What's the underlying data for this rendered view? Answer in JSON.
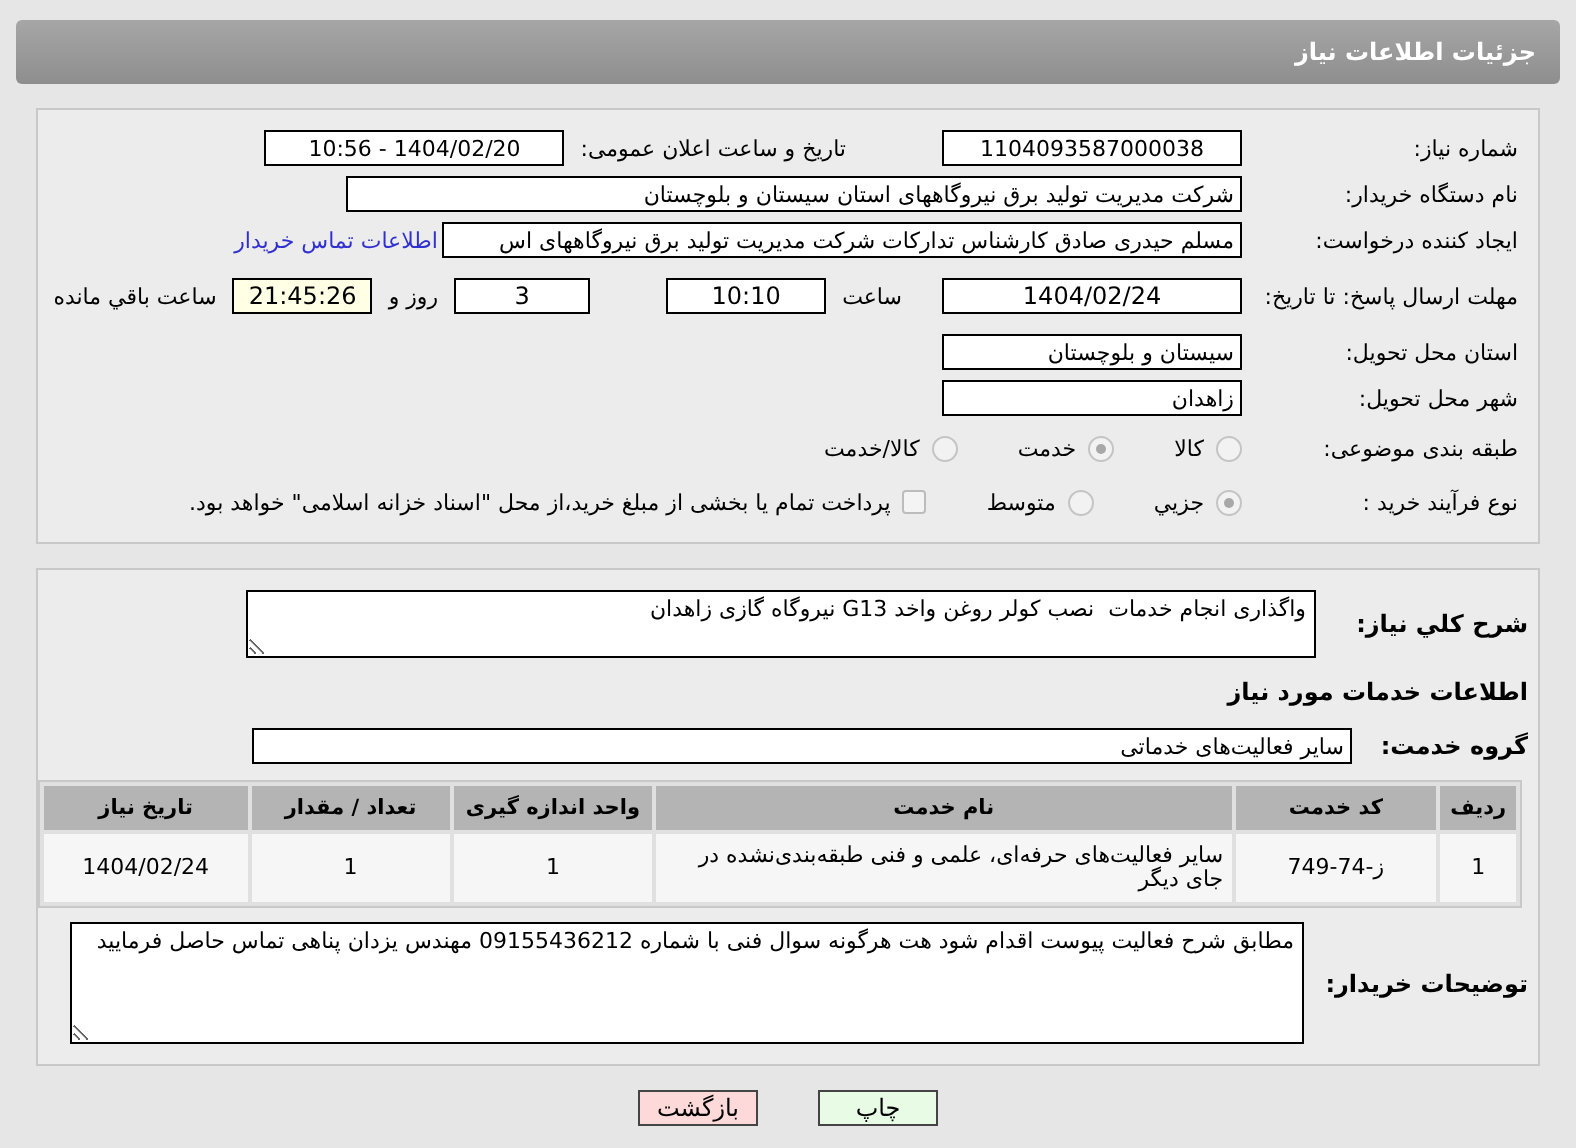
{
  "page_title": "جزئیات اطلاعات نیاز",
  "need_number": {
    "label": "شماره نیاز:",
    "value": "1104093587000038"
  },
  "announce": {
    "label": "تاریخ و ساعت اعلان عمومی:",
    "value": "1404/02/20 - 10:56"
  },
  "buyer_org": {
    "label": "نام دستگاه خریدار:",
    "value": "شرکت مدیریت تولید برق نیروگاههای استان سیستان و بلوچستان"
  },
  "requester": {
    "label": "ایجاد کننده درخواست:",
    "value": "مسلم حیدری صادق کارشناس تدارکات شرکت مدیریت تولید برق نیروگاههای اس",
    "link": "اطلاعات تماس خریدار"
  },
  "deadline": {
    "label": "مهلت ارسال پاسخ: تا تاریخ:",
    "date": "1404/02/24",
    "time_label": "ساعت",
    "time": "10:10",
    "days": "3",
    "days_label": "روز و",
    "remaining": "21:45:26",
    "remaining_label": "ساعت باقي مانده"
  },
  "province": {
    "label": "استان محل تحویل:",
    "value": "سیستان و بلوچستان"
  },
  "city": {
    "label": "شهر محل تحویل:",
    "value": "زاهدان"
  },
  "category": {
    "label": "طبقه بندی موضوعی:",
    "options": [
      {
        "label": "کالا",
        "selected": false
      },
      {
        "label": "خدمت",
        "selected": true
      },
      {
        "label": "کالا/خدمت",
        "selected": false
      }
    ]
  },
  "purchase_type": {
    "label": "نوع فرآیند خرید :",
    "options": [
      {
        "label": "جزیي",
        "selected": true
      },
      {
        "label": "متوسط",
        "selected": false
      }
    ],
    "payment": {
      "checked": false,
      "text": "پرداخت تمام یا بخشی از مبلغ خرید،از محل \"اسناد خزانه اسلامی\" خواهد بود."
    }
  },
  "summary": {
    "label": "شرح کلي نياز:",
    "value": "واگذاری انجام خدمات  نصب کولر روغن واخد G13 نیروگاه گازی زاهدان"
  },
  "services_heading": "اطلاعات خدمات مورد نیاز",
  "service_group": {
    "label": "گروه خدمت:",
    "value": "سایر فعالیت‌های خدماتی"
  },
  "table": {
    "columns": [
      "ردیف",
      "کد خدمت",
      "نام خدمت",
      "واحد اندازه گیری",
      "تعداد / مقدار",
      "تاریخ نیاز"
    ],
    "rows": [
      [
        "1",
        "ز-74-749",
        "سایر فعالیت‌های حرفه‌ای، علمی و فنی طبقه‌بندی‌نشده در جای دیگر",
        "1",
        "1",
        "1404/02/24"
      ]
    ]
  },
  "buyer_notes": {
    "label": "توضیحات خریدار:",
    "value": "مطابق شرح فعالیت پیوست اقدام شود هت هرگونه سوال فنی با شماره 09155436212 مهندس یزدان پناهی تماس حاصل فرمایید"
  },
  "buttons": [
    {
      "label": "چاپ",
      "kind": "print"
    },
    {
      "label": "بازگشت",
      "kind": "back"
    }
  ]
}
